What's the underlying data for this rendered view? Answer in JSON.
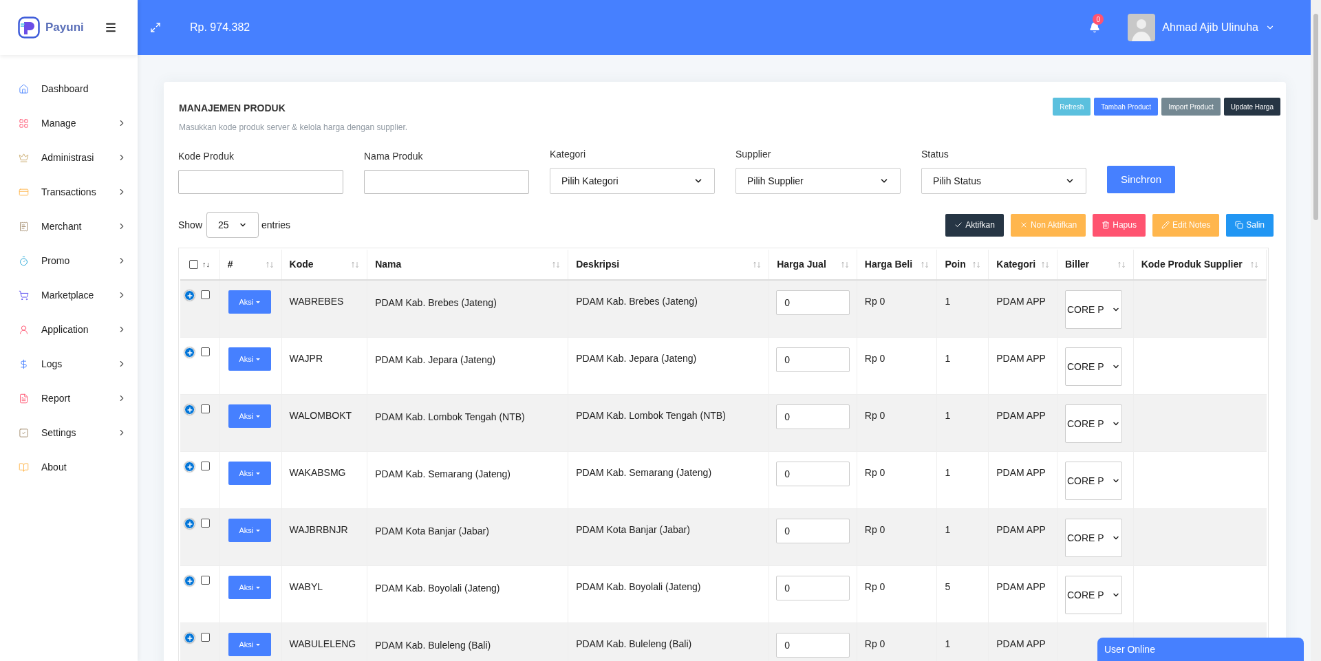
{
  "brand": {
    "name": "Payuni"
  },
  "sidebar": {
    "items": [
      {
        "label": "Dashboard",
        "expandable": false
      },
      {
        "label": "Manage",
        "expandable": true
      },
      {
        "label": "Administrasi",
        "expandable": true
      },
      {
        "label": "Transactions",
        "expandable": true
      },
      {
        "label": "Merchant",
        "expandable": true
      },
      {
        "label": "Promo",
        "expandable": true
      },
      {
        "label": "Marketplace",
        "expandable": true
      },
      {
        "label": "Application",
        "expandable": true
      },
      {
        "label": "Logs",
        "expandable": true
      },
      {
        "label": "Report",
        "expandable": true
      },
      {
        "label": "Settings",
        "expandable": true
      },
      {
        "label": "About",
        "expandable": false
      }
    ]
  },
  "header": {
    "balance": "Rp. 974.382",
    "notification_count": "0",
    "user_name": "Ahmad Ajib Ulinuha"
  },
  "card": {
    "title": "MANAJEMEN PRODUK",
    "subtitle": "Masukkan kode produk server & kelola harga dengan supplier.",
    "top_buttons": [
      "Refresh",
      "Tambah Product",
      "Import Product",
      "Update Harga"
    ],
    "filters": [
      {
        "label": "Kode Produk",
        "kind": "input"
      },
      {
        "label": "Nama Produk",
        "kind": "input"
      },
      {
        "label": "Kategori",
        "kind": "select",
        "placeholder": "Pilih Kategori"
      },
      {
        "label": "Supplier",
        "kind": "select",
        "placeholder": "Pilih Supplier"
      },
      {
        "label": "Status",
        "kind": "select",
        "placeholder": "Pilih Status"
      }
    ],
    "sync_button": "Sinchron",
    "show_label": "Show",
    "entries_value": "25",
    "entries_label": "entries",
    "action_buttons": [
      "Aktifkan",
      "Non Aktifkan",
      "Hapus",
      "Edit Notes",
      "Salin"
    ]
  },
  "table": {
    "columns": [
      "#",
      "Kode",
      "Nama",
      "Deskripsi",
      "Harga Jual",
      "Harga Beli",
      "Poin",
      "Kategori",
      "Biller",
      "Kode Produk Supplier"
    ],
    "select_all_checked": false,
    "select_all_sort": "↑↓",
    "rows": [
      {
        "checked": false,
        "action": "Aksi",
        "kode": "WABREBES",
        "nama": "PDAM Kab. Brebes (Jateng)",
        "deskripsi": "PDAM Kab. Brebes (Jateng)",
        "harga_jual": "0",
        "harga_beli": "Rp 0",
        "poin": "1",
        "kategori": "PDAM APP",
        "biller": "CORE P"
      },
      {
        "checked": false,
        "action": "Aksi",
        "kode": "WAJPR",
        "nama": "PDAM Kab. Jepara (Jateng)",
        "deskripsi": "PDAM Kab. Jepara (Jateng)",
        "harga_jual": "0",
        "harga_beli": "Rp 0",
        "poin": "1",
        "kategori": "PDAM APP",
        "biller": "CORE P"
      },
      {
        "checked": false,
        "action": "Aksi",
        "kode": "WALOMBOKT",
        "nama": "PDAM Kab. Lombok Tengah (NTB)",
        "deskripsi": "PDAM Kab. Lombok Tengah (NTB)",
        "harga_jual": "0",
        "harga_beli": "Rp 0",
        "poin": "1",
        "kategori": "PDAM APP",
        "biller": "CORE P"
      },
      {
        "checked": false,
        "action": "Aksi",
        "kode": "WAKABSMG",
        "nama": "PDAM Kab. Semarang (Jateng)",
        "deskripsi": "PDAM Kab. Semarang (Jateng)",
        "harga_jual": "0",
        "harga_beli": "Rp 0",
        "poin": "1",
        "kategori": "PDAM APP",
        "biller": "CORE P"
      },
      {
        "checked": false,
        "action": "Aksi",
        "kode": "WAJBRBNJR",
        "nama": "PDAM Kota Banjar (Jabar)",
        "deskripsi": "PDAM Kota Banjar (Jabar)",
        "harga_jual": "0",
        "harga_beli": "Rp 0",
        "poin": "1",
        "kategori": "PDAM APP",
        "biller": "CORE P"
      },
      {
        "checked": false,
        "action": "Aksi",
        "kode": "WABYL",
        "nama": "PDAM Kab. Boyolali (Jateng)",
        "deskripsi": "PDAM Kab. Boyolali (Jateng)",
        "harga_jual": "0",
        "harga_beli": "Rp 0",
        "poin": "5",
        "kategori": "PDAM APP",
        "biller": "CORE P"
      },
      {
        "checked": false,
        "action": "Aksi",
        "kode": "WABULELENG",
        "nama": "PDAM Kab. Buleleng (Bali)",
        "deskripsi": "PDAM Kab. Buleleng (Bali)",
        "harga_jual": "0",
        "harga_beli": "Rp 0",
        "poin": "1",
        "kategori": "PDAM APP"
      }
    ]
  },
  "chat_widget": {
    "label": "User Online"
  }
}
